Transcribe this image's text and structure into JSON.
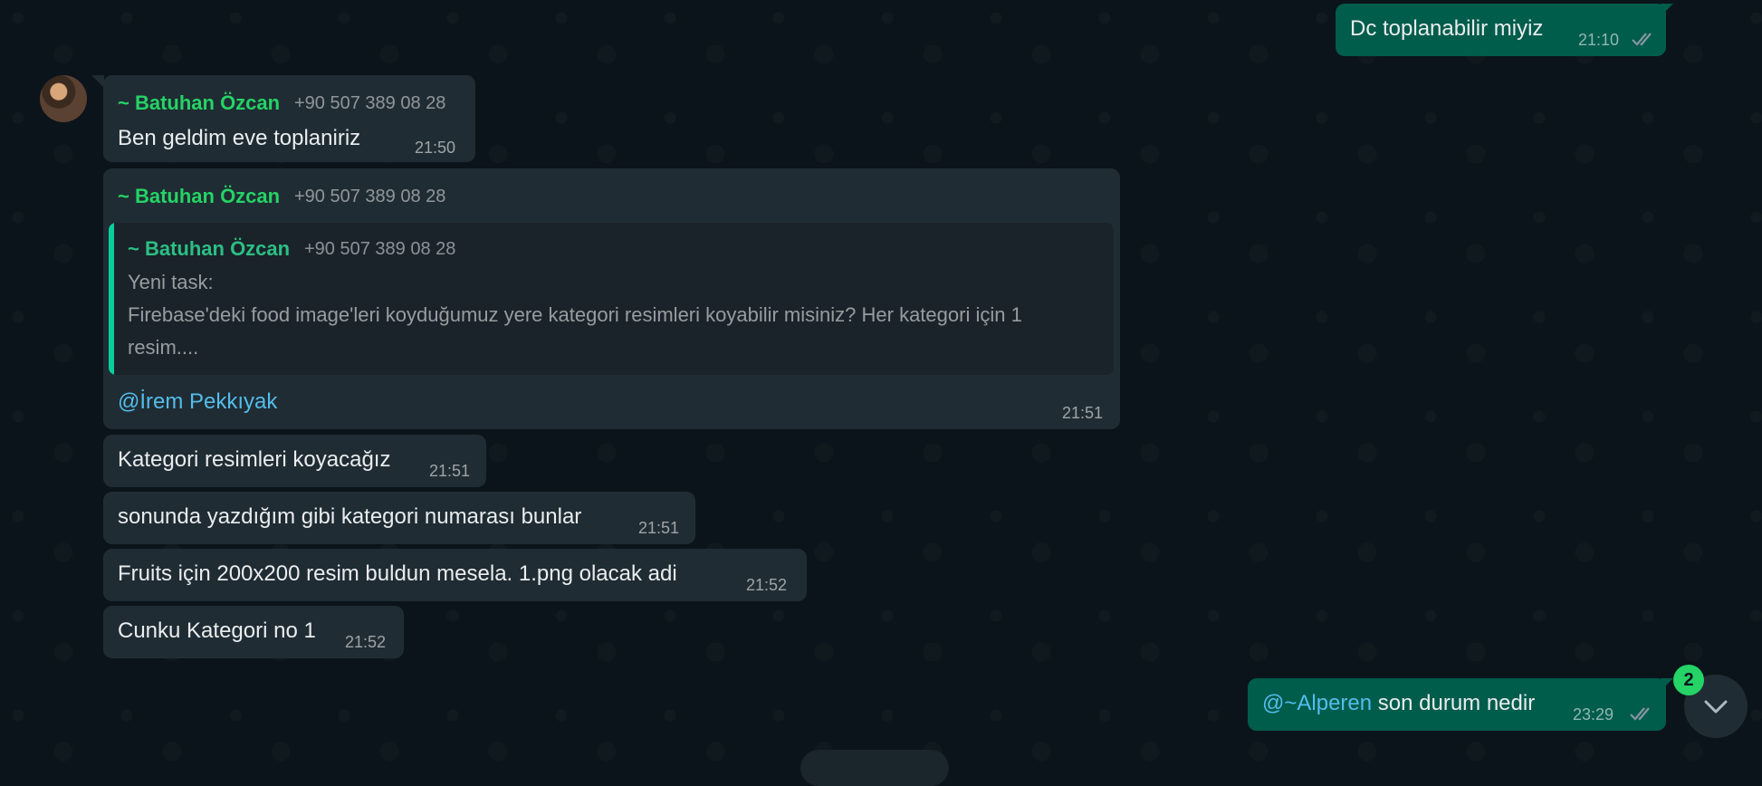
{
  "messages": {
    "m1": {
      "text": "Dc toplanabilir miyiz",
      "time": "21:10"
    },
    "m2": {
      "sender": "~ Batuhan Özcan",
      "phone": "+90 507 389 08 28",
      "text": "Ben geldim eve toplaniriz",
      "time": "21:50"
    },
    "m3": {
      "sender": "~ Batuhan Özcan",
      "phone": "+90 507 389 08 28",
      "quote": {
        "sender": "~ Batuhan Özcan",
        "phone": "+90 507 389 08 28",
        "line1": "Yeni task:",
        "line2": "Firebase'deki food image'leri koyduğumuz yere kategori resimleri koyabilir misiniz? Her kategori için 1",
        "line3": "resim...."
      },
      "mention": "@İrem Pekkıyak",
      "time": "21:51"
    },
    "m4": {
      "text": "Kategori resimleri koyacağız",
      "time": "21:51"
    },
    "m5": {
      "text": "sonunda yazdığım gibi kategori numarası bunlar",
      "time": "21:51"
    },
    "m6": {
      "text": "Fruits için 200x200 resim buldun mesela. 1.png olacak adi",
      "time": "21:52"
    },
    "m7": {
      "text": "Cunku Kategori no 1",
      "time": "21:52"
    },
    "m8": {
      "mention": "@~Alperen",
      "text": " son durum nedir",
      "time": "23:29"
    }
  },
  "scroll_down": {
    "unread_count": "2",
    "icon": "chevron-down-icon"
  },
  "avatar_icon": "user-avatar",
  "colors": {
    "outgoing": "#005c4b",
    "incoming": "#202c33",
    "sender": "#25d366",
    "mention": "#53bdeb",
    "tick": "#8696a0"
  }
}
